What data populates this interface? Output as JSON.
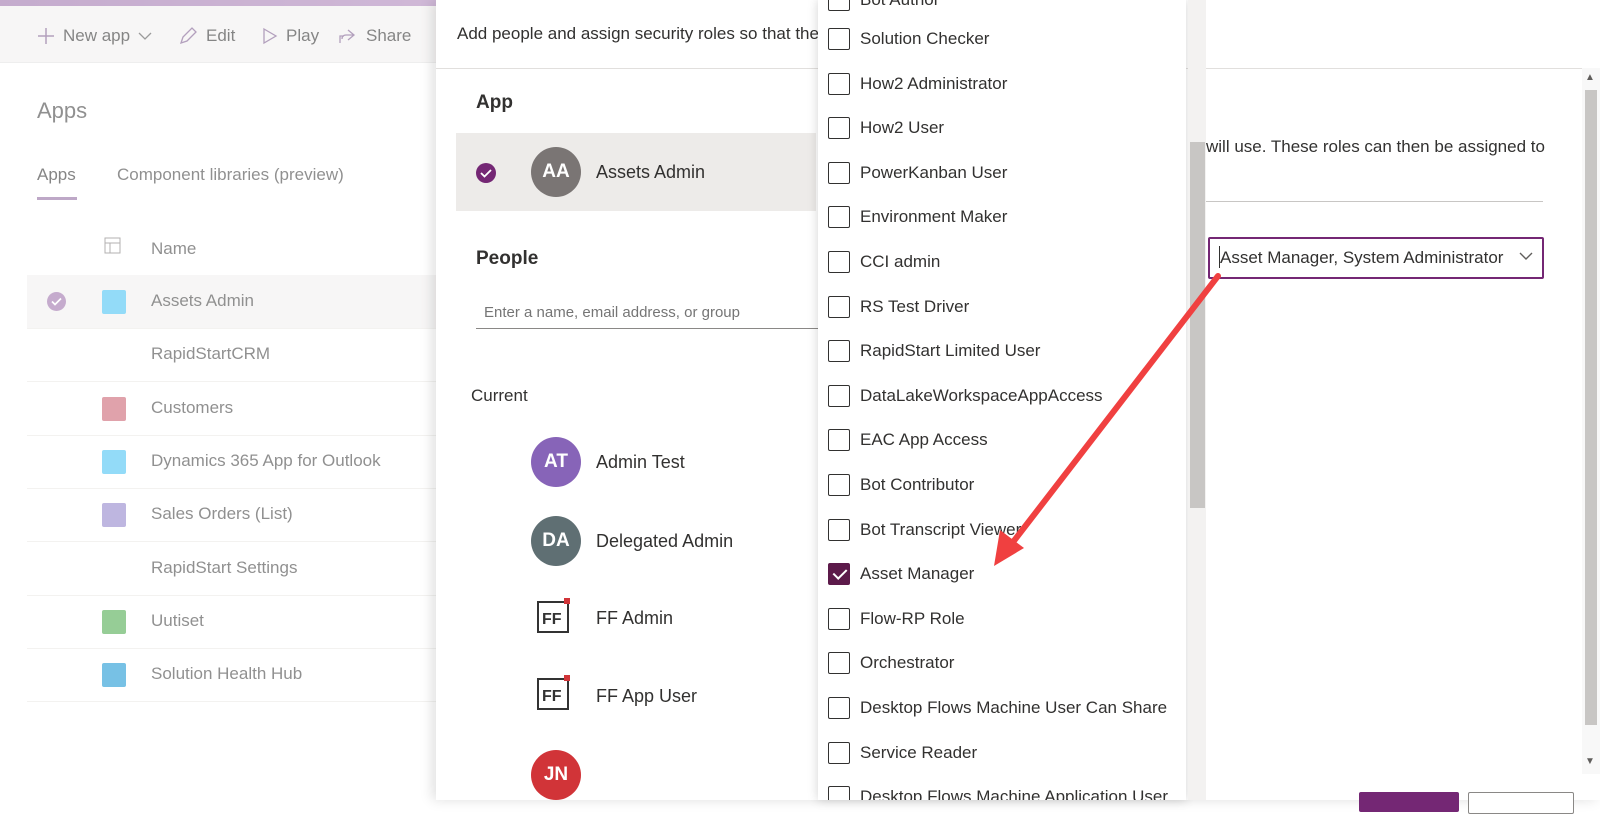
{
  "cmdbar": {
    "new_app": "New app",
    "edit": "Edit",
    "play": "Play",
    "share": "Share"
  },
  "apps": {
    "heading": "Apps",
    "tabs": [
      "Apps",
      "Component libraries (preview)"
    ],
    "column_name": "Name",
    "rows": [
      {
        "name": "Assets Admin",
        "icon_color": "#5ac8f5",
        "selected": true
      },
      {
        "name": "RapidStartCRM",
        "icon_color": "",
        "selected": false
      },
      {
        "name": "Customers",
        "icon_color": "#d0707f",
        "selected": false
      },
      {
        "name": "Dynamics 365 App for Outlook",
        "icon_color": "#5ac8f5",
        "selected": false
      },
      {
        "name": "Sales Orders (List)",
        "icon_color": "#9b8fcf",
        "selected": false
      },
      {
        "name": "RapidStart Settings",
        "icon_color": "",
        "selected": false
      },
      {
        "name": "Uutiset",
        "icon_color": "#5fb35f",
        "selected": false
      },
      {
        "name": "Solution Health Hub",
        "icon_color": "#2ea0d8",
        "selected": false
      }
    ]
  },
  "panel": {
    "description": "Add people and assign security roles so that the",
    "app_label": "App",
    "app_initials": "AA",
    "app_name": "Assets Admin",
    "people_label": "People",
    "people_placeholder": "Enter a name, email address, or group",
    "current_label": "Current",
    "current_people": [
      {
        "initials": "AT",
        "name": "Admin Test",
        "color": "#8764b8"
      },
      {
        "initials": "DA",
        "name": "Delegated Admin",
        "color": "#5f6f73"
      },
      {
        "initials": "FF",
        "name": "FF Admin",
        "color": ""
      },
      {
        "initials": "FF",
        "name": "FF App User",
        "color": ""
      },
      {
        "initials": "JN",
        "name": "",
        "color": "#d13438"
      }
    ],
    "right_description": "will use. These roles can then be assigned to",
    "roles_value": "Asset Manager, System Administrator"
  },
  "roles": {
    "partial_top": "Bot Author",
    "items": [
      {
        "label": "Solution Checker",
        "checked": false
      },
      {
        "label": "How2 Administrator",
        "checked": false
      },
      {
        "label": "How2 User",
        "checked": false
      },
      {
        "label": "PowerKanban User",
        "checked": false
      },
      {
        "label": "Environment Maker",
        "checked": false
      },
      {
        "label": "CCI admin",
        "checked": false
      },
      {
        "label": "RS Test Driver",
        "checked": false
      },
      {
        "label": "RapidStart Limited User",
        "checked": false
      },
      {
        "label": "DataLakeWorkspaceAppAccess",
        "checked": false
      },
      {
        "label": "EAC App Access",
        "checked": false
      },
      {
        "label": "Bot Contributor",
        "checked": false
      },
      {
        "label": "Bot Transcript Viewer",
        "checked": false
      },
      {
        "label": "Asset Manager",
        "checked": true
      },
      {
        "label": "Flow-RP Role",
        "checked": false
      },
      {
        "label": "Orchestrator",
        "checked": false
      },
      {
        "label": "Desktop Flows Machine User Can Share",
        "checked": false
      },
      {
        "label": "Service Reader",
        "checked": false
      },
      {
        "label": "Desktop Flows Machine Application User",
        "checked": false
      }
    ]
  },
  "colors": {
    "accent": "#742774",
    "annotation_arrow": "#f04040"
  }
}
